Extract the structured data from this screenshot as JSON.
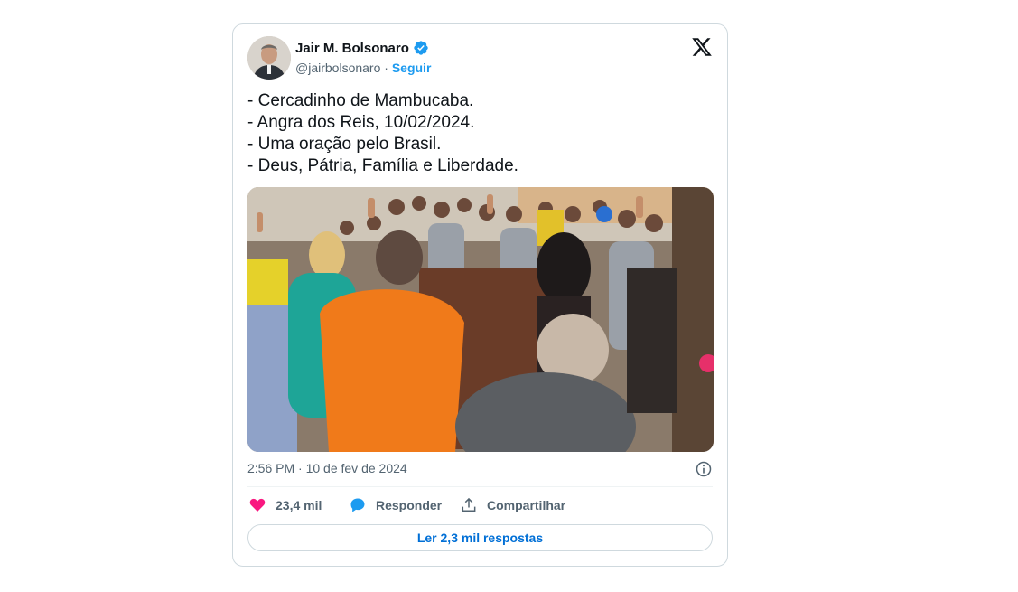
{
  "author": {
    "name": "Jair M. Bolsonaro",
    "handle": "@jairbolsonaro",
    "separator": "·",
    "follow_label": "Seguir",
    "verified_icon": "verified-badge-icon",
    "verified_color": "#1d9bf0"
  },
  "brand_icon": "x-logo-icon",
  "tweet": {
    "lines": [
      "- Cercadinho de Mambucaba.",
      "- Angra dos Reis, 10/02/2024.",
      "- Uma oração pelo Brasil.",
      "- Deus, Pátria, Família e Liberdade."
    ],
    "timestamp": "2:56 PM · 10 de fev de 2024"
  },
  "actions": {
    "like_count": "23,4 mil",
    "like_color": "#f91880",
    "reply_label": "Responder",
    "reply_color": "#1d9bf0",
    "share_label": "Compartilhar"
  },
  "read_replies_label": "Ler 2,3 mil respostas",
  "colors": {
    "link": "#1d9bf0",
    "text": "#0f1419",
    "secondary": "#536471",
    "border": "#cfd9de"
  }
}
